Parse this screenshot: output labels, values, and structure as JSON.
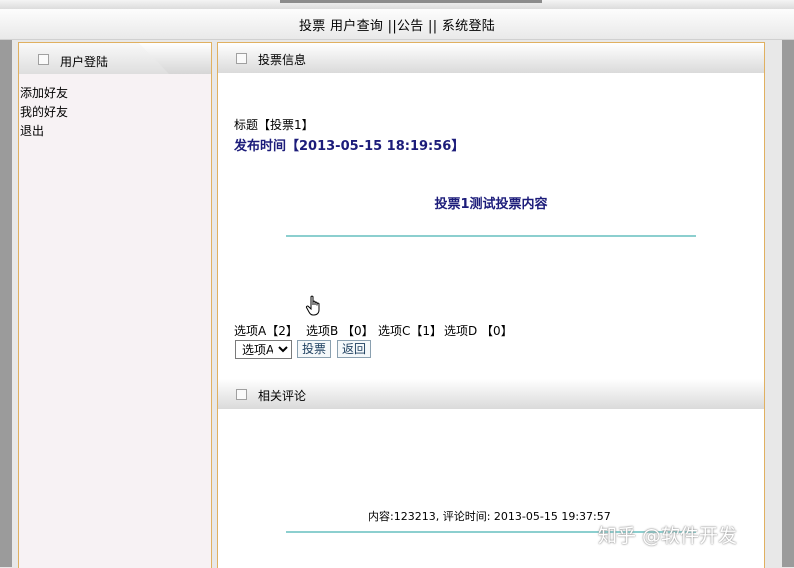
{
  "nav": {
    "vote": "投票",
    "user_query": "用户查询",
    "sep1": " ||",
    "announcement": "公告",
    "sep2": " || ",
    "system_login": "系统登陆"
  },
  "sidebar": {
    "title": "用户登陆",
    "items": [
      {
        "label": "添加好友"
      },
      {
        "label": "我的好友"
      },
      {
        "label": "退出"
      }
    ]
  },
  "vote_info": {
    "section_title": "投票信息",
    "title_line": "标题【投票1】",
    "publish_label": "发布时间【2013-05-15 18:19:56】",
    "content": "投票1测试投票内容",
    "options_summary": [
      "选项A【2】",
      "选项B 【0】",
      "选项C【1】",
      "选项D 【0】"
    ],
    "select_value": "选项A",
    "vote_button": "投票",
    "back_button": "返回"
  },
  "comments": {
    "section_title": "相关评论",
    "items": [
      {
        "text": "内容:123213, 评论时间: 2013-05-15 19:37:57"
      }
    ]
  },
  "watermark": "知乎 @软件开发",
  "colors": {
    "panel_border": "#e0b060",
    "heading_blue": "#1c1c7a",
    "rule_teal": "#8ccfcf"
  }
}
